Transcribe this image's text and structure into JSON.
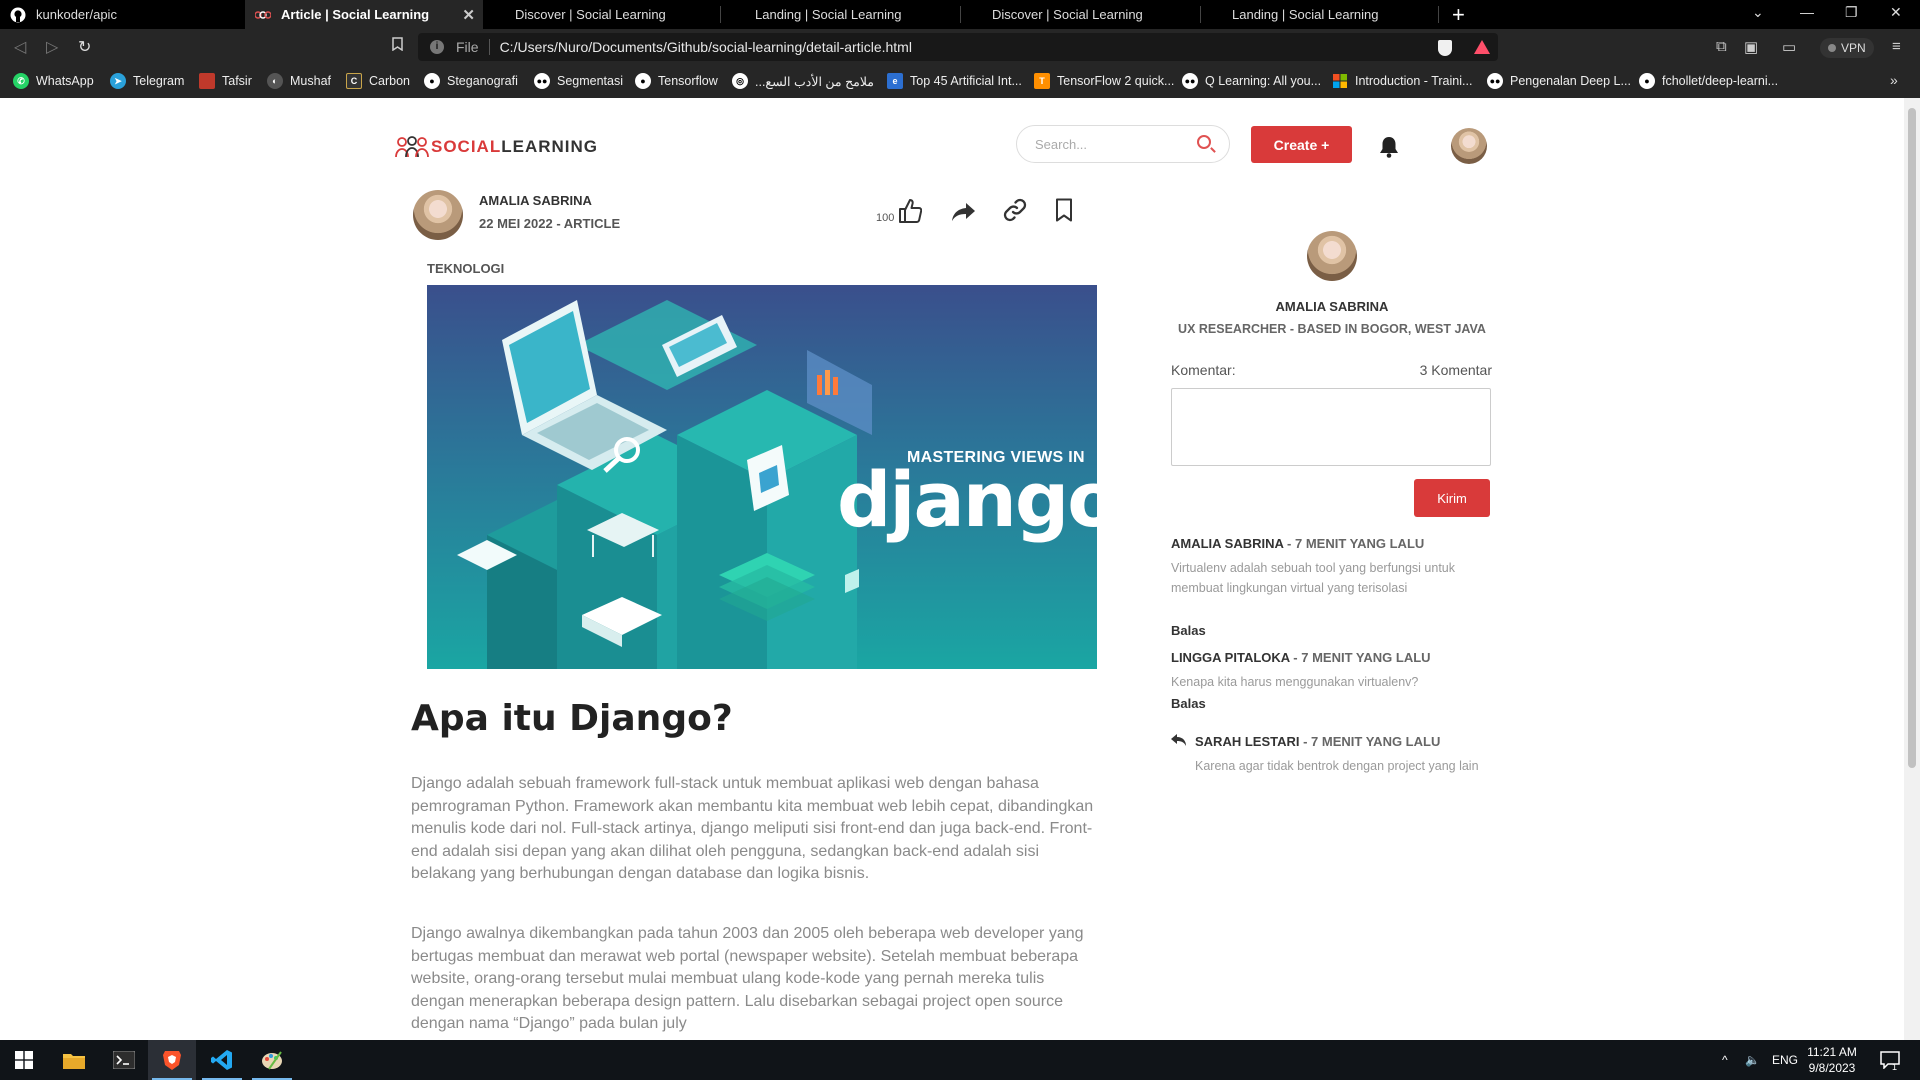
{
  "browser": {
    "tabs": [
      {
        "title": "kunkoder/apic",
        "icon": "github-icon",
        "active": false
      },
      {
        "title": "Article | Social Learning",
        "icon": "page-logo-icon",
        "active": true
      },
      {
        "title": "Discover | Social Learning",
        "icon": "none",
        "active": false
      },
      {
        "title": "Landing | Social Learning",
        "icon": "none",
        "active": false
      },
      {
        "title": "Discover | Social Learning",
        "icon": "none",
        "active": false
      },
      {
        "title": "Landing | Social Learning",
        "icon": "none",
        "active": false
      }
    ],
    "address": {
      "scheme": "File",
      "url": "C:/Users/Nuro/Documents/Github/social-learning/detail-article.html"
    },
    "vpn_label": "VPN",
    "bookmarks": [
      {
        "label": "WhatsApp",
        "icon": "whatsapp-icon",
        "color": "#25d366"
      },
      {
        "label": "Telegram",
        "icon": "telegram-icon",
        "color": "#2aa1da"
      },
      {
        "label": "Tafsir",
        "icon": "tafsir-icon",
        "color": "#c0392b"
      },
      {
        "label": "Mushaf",
        "icon": "mushaf-icon",
        "color": "#555555"
      },
      {
        "label": "Carbon",
        "icon": "carbon-icon",
        "color": "#333333"
      },
      {
        "label": "Steganografi",
        "icon": "github-icon",
        "color": "#444444"
      },
      {
        "label": "Segmentasi",
        "icon": "medium-icon",
        "color": "#111111"
      },
      {
        "label": "Tensorflow",
        "icon": "github-icon",
        "color": "#444444"
      },
      {
        "label": "...ملامح من الأدب السع",
        "icon": "web-icon",
        "color": "#666666"
      },
      {
        "label": "Top 45 Artificial Int...",
        "icon": "elearning-icon",
        "color": "#2c6fd1"
      },
      {
        "label": "TensorFlow 2 quick...",
        "icon": "tensorflow-icon",
        "color": "#ff8f00"
      },
      {
        "label": "Q Learning: All you...",
        "icon": "medium-icon",
        "color": "#111111"
      },
      {
        "label": "Introduction - Traini...",
        "icon": "microsoft-icon",
        "color": "#f25022"
      },
      {
        "label": "Pengenalan Deep L...",
        "icon": "medium-icon",
        "color": "#111111"
      },
      {
        "label": "fchollet/deep-learni...",
        "icon": "github-icon",
        "color": "#444444"
      }
    ]
  },
  "site": {
    "logo_part1": "SOCIAL",
    "logo_part2": "LEARNING",
    "search_placeholder": "Search...",
    "create_label": "Create +",
    "accent": "#d93a3a"
  },
  "article": {
    "author": "AMALIA SABRINA",
    "meta": "22 MEI 2022 - ARTICLE",
    "likes": "100",
    "category": "TEKNOLOGI",
    "hero_subtitle": "MASTERING VIEWS IN",
    "hero_title": "django",
    "title": "Apa itu Django?",
    "paragraphs": [
      "Django adalah sebuah framework full-stack untuk membuat aplikasi web dengan bahasa pemrograman Python. Framework akan membantu kita membuat web lebih cepat, dibandingkan menulis kode dari nol. Full-stack artinya, django meliputi sisi front-end dan juga back-end. Front-end adalah sisi depan yang akan dilihat oleh pengguna, sedangkan back-end adalah sisi belakang yang berhubungan dengan database dan logika bisnis.",
      "Django awalnya dikembangkan pada tahun 2003 dan 2005 oleh beberapa web developer yang bertugas membuat dan merawat web portal (newspaper website). Setelah membuat beberapa website, orang-orang tersebut mulai membuat ulang kode-kode yang pernah mereka tulis dengan menerapkan beberapa design pattern. Lalu disebarkan sebagai project open source dengan nama “Django” pada bulan july"
    ]
  },
  "sidebar": {
    "name": "AMALIA SABRINA",
    "role": "UX RESEARCHER - BASED IN BOGOR, WEST JAVA",
    "komentar_label": "Komentar:",
    "komentar_count": "3 Komentar",
    "send_label": "Kirim",
    "comments": [
      {
        "author": "AMALIA SABRINA",
        "time": " - 7 MENIT YANG LALU",
        "text": "Virtualenv adalah sebuah tool yang berfungsi untuk membuat lingkungan virtual yang terisolasi",
        "reply": "Balas"
      },
      {
        "author": "LINGGA PITALOKA",
        "time": " - 7 MENIT YANG LALU",
        "text": "Kenapa kita harus menggunakan virtualenv?",
        "reply": "Balas"
      },
      {
        "author": "SARAH LESTARI",
        "time": " - 7 MENIT YANG LALU",
        "text": "Karena agar tidak bentrok dengan project yang lain",
        "reply": ""
      }
    ]
  },
  "taskbar": {
    "apps": [
      "windows-start-icon",
      "file-explorer-icon",
      "terminal-icon",
      "brave-icon",
      "vscode-icon",
      "paint-icon"
    ],
    "language": "ENG",
    "time": "11:21 AM",
    "date": "9/8/2023",
    "notifications": "1"
  }
}
